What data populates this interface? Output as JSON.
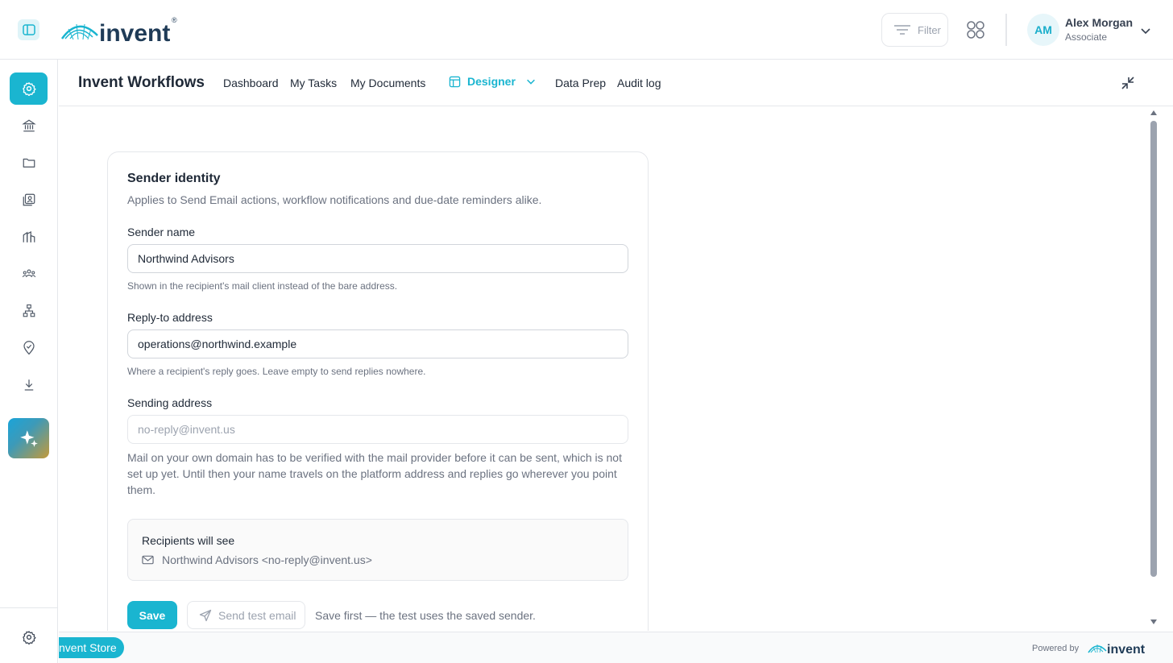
{
  "header": {
    "brand": "invent",
    "filter_label": "Filter",
    "user": {
      "initials": "AM",
      "name": "Alex Morgan",
      "role": "Associate"
    }
  },
  "leftnav": {
    "items": [
      {
        "icon": "gear-icon",
        "active": true
      },
      {
        "icon": "bank-icon",
        "active": false
      },
      {
        "icon": "folder-icon",
        "active": false
      },
      {
        "icon": "contacts-icon",
        "active": false
      },
      {
        "icon": "buildings-icon",
        "active": false
      },
      {
        "icon": "team-icon",
        "active": false
      },
      {
        "icon": "hierarchy-icon",
        "active": false
      },
      {
        "icon": "location-check-icon",
        "active": false
      },
      {
        "icon": "download-icon",
        "active": false
      }
    ],
    "ai_icon": "sparkles-icon",
    "settings_icon": "gear-icon"
  },
  "subheader": {
    "title": "Invent Workflows",
    "menu": [
      "Dashboard",
      "My Tasks",
      "My Documents"
    ],
    "active_menu": "Designer",
    "menu_after": [
      "Data Prep",
      "Audit log"
    ]
  },
  "card": {
    "title": "Sender identity",
    "subtitle": "Applies to Send Email actions, workflow notifications and due-date reminders alike.",
    "sender_name": {
      "label": "Sender name",
      "value": "Northwind Advisors",
      "help": "Shown in the recipient's mail client instead of the bare address."
    },
    "reply_to": {
      "label": "Reply-to address",
      "value": "operations@northwind.example",
      "help": "Where a recipient's reply goes. Leave empty to send replies nowhere."
    },
    "sending_address": {
      "label": "Sending address",
      "placeholder": "no-reply@invent.us",
      "note": "Mail on your own domain has to be verified with the mail provider before it can be sent, which is not set up yet. Until then your name travels on the platform address and replies go wherever you point them."
    },
    "preview": {
      "title": "Recipients will see",
      "value": "Northwind Advisors <no-reply@invent.us>"
    },
    "actions": {
      "save": "Save",
      "test": "Send test email",
      "hint": "Save first — the test uses the saved sender."
    }
  },
  "footer": {
    "store": "nvent Store",
    "powered_by": "Powered by",
    "powered_brand": "invent"
  },
  "colors": {
    "accent": "#1ab5d0",
    "accent_light": "#dff4f8",
    "border": "#e5e7eb",
    "muted_text": "#6b7280"
  }
}
